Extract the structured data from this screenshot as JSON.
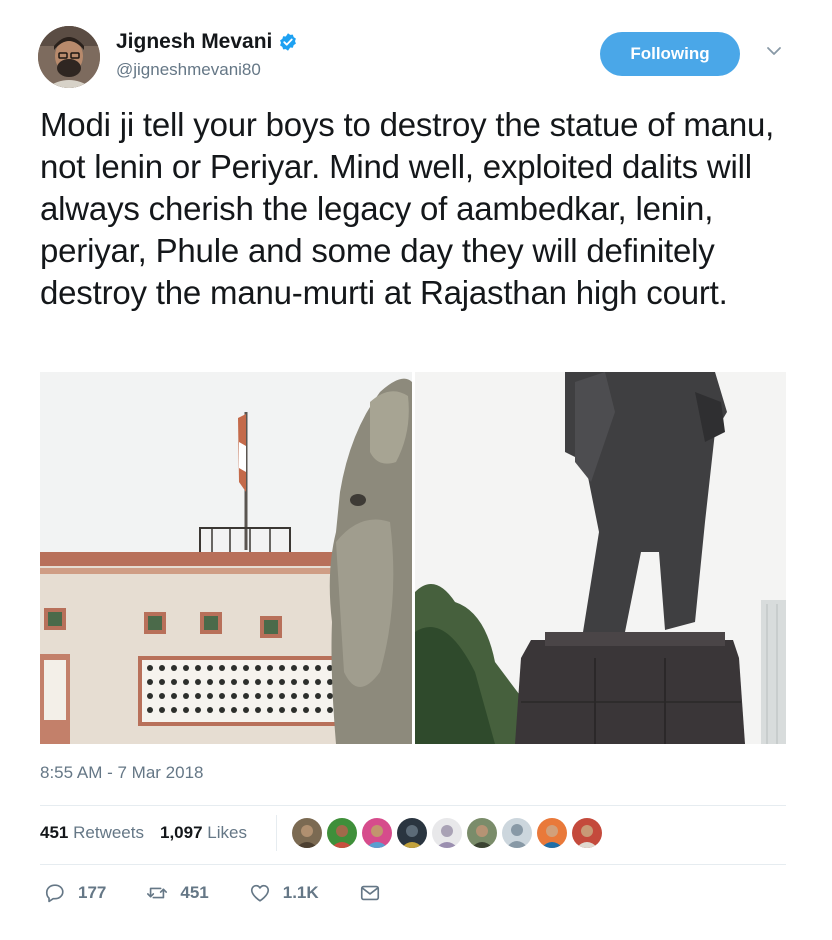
{
  "author": {
    "display_name": "Jignesh Mevani",
    "handle": "@jigneshmevani80",
    "verified_icon": "verified-badge-icon"
  },
  "follow_button": {
    "label": "Following",
    "color": "#4aa7e8"
  },
  "menu_icon": "chevron-down-icon",
  "tweet": {
    "text": "Modi ji tell your boys to destroy the statue of manu, not lenin or Periyar. Mind well, exploited dalits will always cherish the legacy of aambedkar, lenin, periyar, Phule and some day they will definitely destroy the manu-murti at Rajasthan high court."
  },
  "media": {
    "count": 2
  },
  "timestamp": "8:55 AM - 7 Mar 2018",
  "stats": {
    "retweets_count": "451",
    "retweets_label": "Retweets",
    "likes_count": "1,097",
    "likes_label": "Likes",
    "liker_avatars_count": 9
  },
  "actions": {
    "reply_count": "177",
    "retweet_count": "451",
    "like_count": "1.1K"
  },
  "colors": {
    "text": "#14171a",
    "secondary": "#657786",
    "divider": "#e6ecf0",
    "accent": "#1da1f2"
  }
}
